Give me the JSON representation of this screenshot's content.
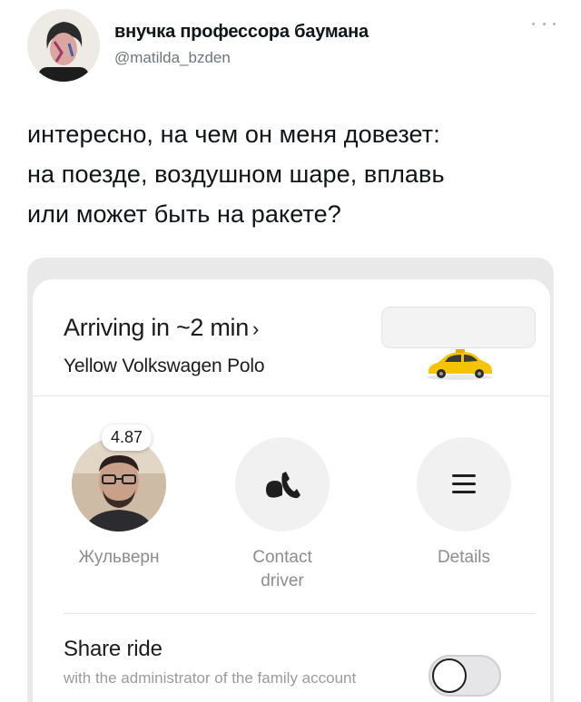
{
  "tweet": {
    "author": {
      "display_name": "внучка профессора баумана",
      "handle": "@matilda_bzden"
    },
    "text_lines": [
      "интересно, на чем он меня довезет:",
      "на поезде, воздушном шаре, вплавь",
      "или может быть на ракете?"
    ],
    "more_icon": "more-horizontal-icon"
  },
  "taxi_screenshot": {
    "arrival": {
      "title": "Arriving in ~2 min",
      "chevron": "›"
    },
    "car_model": "Yellow Volkswagen Polo",
    "car_icon": "yellow-car-icon",
    "driver": {
      "name": "Жульверн",
      "rating": "4.87"
    },
    "actions": {
      "contact_label_line1": "Contact",
      "contact_label_line2": "driver",
      "contact_icon": "phone-icon",
      "details_label": "Details",
      "details_icon": "menu-icon"
    },
    "share": {
      "title": "Share ride",
      "description": "with the administrator of the family account",
      "toggle_on": false
    }
  },
  "colors": {
    "text_primary": "#0f1419",
    "text_secondary": "#6e767d",
    "car_yellow": "#f5c400",
    "label_grey": "#8c8c91"
  }
}
